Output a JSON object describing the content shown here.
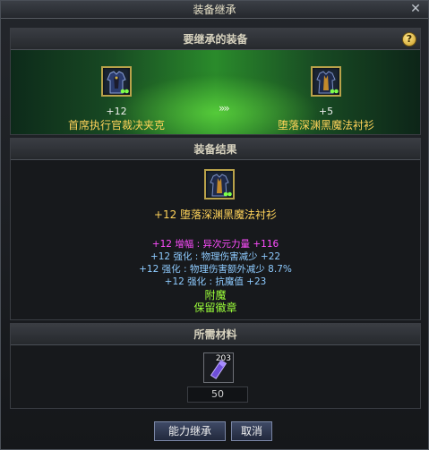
{
  "window": {
    "title": "装备继承"
  },
  "sections": {
    "inherit": "要继承的装备",
    "result": "装备结果",
    "materials": "所需材料"
  },
  "source_item": {
    "plus": "+12",
    "name": "首席执行官裁决夹克"
  },
  "target_item": {
    "plus": "+5",
    "name": "堕落深渊黑魔法衬衫"
  },
  "arrow": "»»",
  "result": {
    "title": "+12  堕落深渊黑魔法衬衫",
    "stats": [
      {
        "text": "+12  增幅 : 异次元力量 +116",
        "color": "#ff4dff"
      },
      {
        "text": "+12  强化 : 物理伤害减少 +22",
        "color": "#8ecbff"
      },
      {
        "text": "+12  强化 : 物理伤害额外减少 8.7%",
        "color": "#8ecbff"
      },
      {
        "text": "+12  强化 : 抗魔值 +23",
        "color": "#8ecbff"
      },
      {
        "text": "附魔",
        "color": "#9cff3a"
      },
      {
        "text": "保留徽章",
        "color": "#9cff3a"
      }
    ]
  },
  "material": {
    "owned": "203",
    "required": "50"
  },
  "buttons": {
    "confirm": "能力继承",
    "cancel": "取消"
  },
  "help_symbol": "?",
  "close_symbol": "✕"
}
